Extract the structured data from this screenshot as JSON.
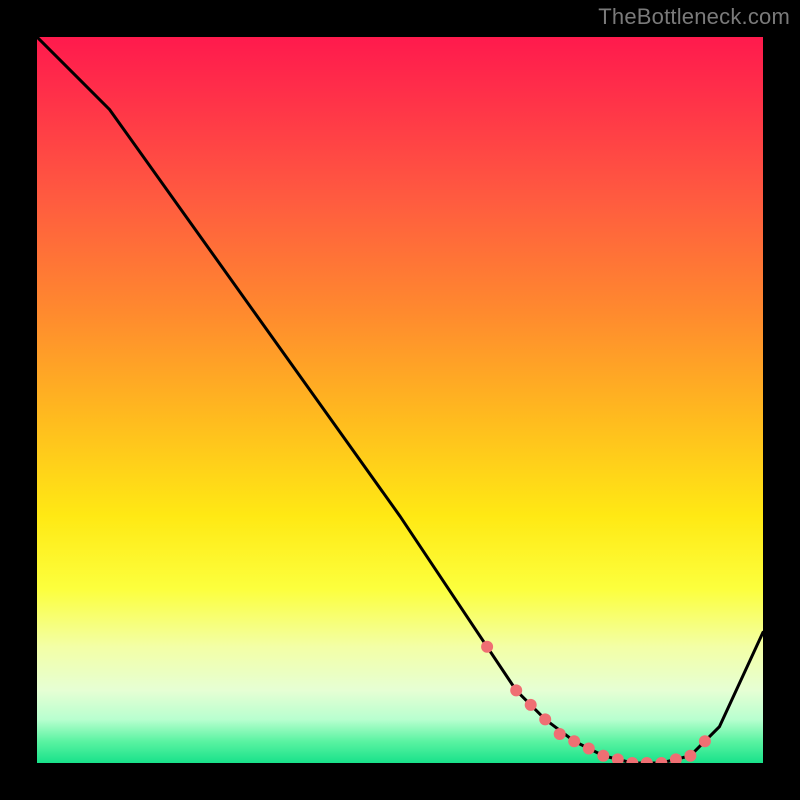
{
  "attribution": "TheBottleneck.com",
  "chart_data": {
    "type": "line",
    "title": "",
    "xlabel": "",
    "ylabel": "",
    "xlim": [
      0,
      100
    ],
    "ylim": [
      0,
      100
    ],
    "grid": false,
    "legend": false,
    "series": [
      {
        "name": "curve",
        "x": [
          0,
          6,
          10,
          20,
          30,
          40,
          50,
          58,
          62,
          66,
          70,
          74,
          78,
          82,
          86,
          90,
          94,
          100
        ],
        "y": [
          100,
          94,
          90,
          76,
          62,
          48,
          34,
          22,
          16,
          10,
          6,
          3,
          1,
          0,
          0,
          1,
          5,
          18
        ]
      }
    ],
    "markers": {
      "name": "trough-dots",
      "x": [
        62,
        66,
        68,
        70,
        72,
        74,
        76,
        78,
        80,
        82,
        84,
        86,
        88,
        90,
        92
      ],
      "y": [
        16,
        10,
        8,
        6,
        4,
        3,
        2,
        1,
        0.5,
        0,
        0,
        0,
        0.5,
        1,
        3
      ],
      "color": "#ef6f73",
      "radius_px": 6
    },
    "background_gradient": {
      "direction": "vertical",
      "stops": [
        {
          "pos": 0.0,
          "color": "#ff1a4d"
        },
        {
          "pos": 0.22,
          "color": "#ff5a40"
        },
        {
          "pos": 0.52,
          "color": "#ffb91f"
        },
        {
          "pos": 0.76,
          "color": "#fcff3d"
        },
        {
          "pos": 0.9,
          "color": "#e6ffd4"
        },
        {
          "pos": 1.0,
          "color": "#18e28a"
        }
      ]
    }
  }
}
